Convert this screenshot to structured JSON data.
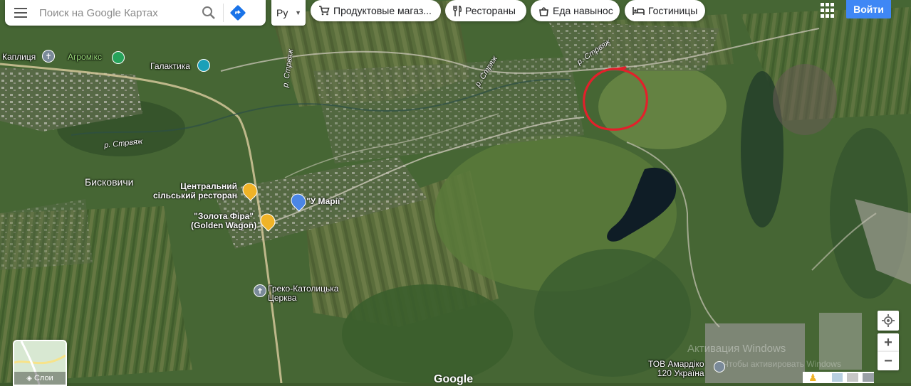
{
  "search": {
    "placeholder": "Поиск на Google Картах"
  },
  "language": {
    "label": "Ру"
  },
  "categories": [
    {
      "label": "Продуктовые магаз...",
      "icon": "cart-icon"
    },
    {
      "label": "Рестораны",
      "icon": "restaurant-icon"
    },
    {
      "label": "Еда навынос",
      "icon": "takeout-icon"
    },
    {
      "label": "Гостиницы",
      "icon": "hotel-icon"
    }
  ],
  "header": {
    "signin_label": "Войти"
  },
  "places": {
    "kaplytsia": "Каплиця",
    "agromix": "Агромікс",
    "galaktika": "Галактика",
    "river1": "р. Стрвяж",
    "river2": "р. Стряж",
    "river3": "р. Стрвяж",
    "river4": "р. Стрвяж",
    "village": "Бисковичи",
    "restaurant1_line1": "Центральний",
    "restaurant1_line2": "сільський ресторан",
    "shop_umarii": "\"У Марії\"",
    "restaurant2_line1": "\"Золота Фіра\"",
    "restaurant2_line2": "(Golden Wagon)",
    "church_line1": "Греко-Католицька",
    "church_line2": "Церква",
    "company_line1": "ТОВ Амардіко",
    "company_line2": "120 Україна"
  },
  "layers": {
    "label": "Слои"
  },
  "footer": {
    "google_logo": "Google",
    "windows_activation_1": "Активация Windows",
    "windows_activation_2": "Чтобы активировать Windows",
    "windows_activation_3": "перейдите в раздел"
  },
  "controls": {
    "zoom_in": "+",
    "zoom_out": "−"
  },
  "colors": {
    "annotation": "#e3202b",
    "accent": "#3f87f5",
    "poi_yellow": "#f0b327",
    "poi_blue": "#4b86e6",
    "poi_green": "#27a35b"
  }
}
